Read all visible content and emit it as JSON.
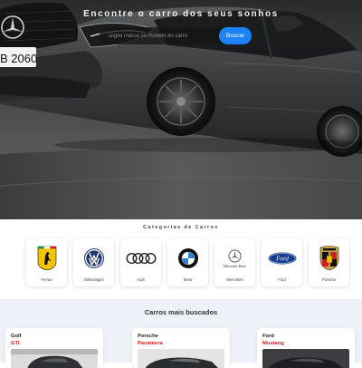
{
  "hero": {
    "title": "Encontre o carro dos seus sonhos",
    "plate_text": "B 2060",
    "search": {
      "placeholder": "Digite marca ou modelo do carro",
      "button_label": "Buscar"
    },
    "colors": {
      "button": "#1d82f5"
    }
  },
  "categories": {
    "title": "Categorias de Carros",
    "items": [
      {
        "name": "Ferrari",
        "icon": "ferrari-logo-icon"
      },
      {
        "name": "Volkswagen",
        "icon": "volkswagen-logo-icon"
      },
      {
        "name": "Audi",
        "icon": "audi-logo-icon"
      },
      {
        "name": "Bmw",
        "icon": "bmw-logo-icon"
      },
      {
        "name": "Mercedes",
        "icon": "mercedes-logo-icon",
        "logo_text": "Mercedes-Benz"
      },
      {
        "name": "Ford",
        "icon": "ford-logo-icon",
        "logo_text": "Ford"
      },
      {
        "name": "Porsche",
        "icon": "porsche-logo-icon"
      }
    ]
  },
  "most_searched": {
    "title": "Carros mais buscados",
    "cars": [
      {
        "brand": "Golf",
        "model": "GTI"
      },
      {
        "brand": "Porsche",
        "model": "Panamera"
      },
      {
        "brand": "Ford",
        "model": "Mustang"
      }
    ],
    "colors": {
      "model": "#e0191b"
    }
  }
}
